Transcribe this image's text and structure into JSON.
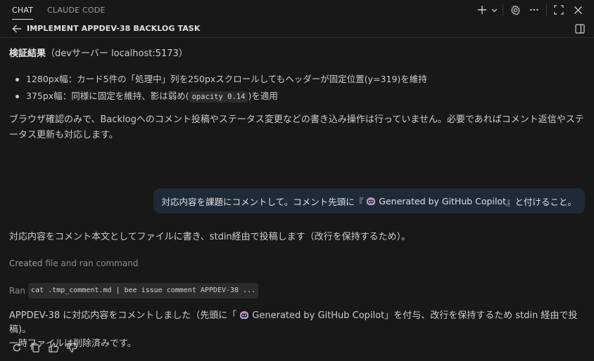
{
  "tabs": {
    "chat": "CHAT",
    "claude_code": "CLAUDE CODE"
  },
  "header": {
    "title": "IMPLEMENT APPDEV-38 BACKLOG TASK"
  },
  "verification": {
    "heading": "検証結果",
    "heading_suffix": "（devサーバー localhost:5173）",
    "bullet1": "1280px幅：カード5件の「処理中」列を250pxスクロールしてもヘッダーが固定位置(y=319)を維持",
    "bullet2_pre": "375px幅：同様に固定を維持、影は弱め(",
    "bullet2_code": "opacity 0.14",
    "bullet2_post": ")を適用"
  },
  "paragraph1": "ブラウザ確認のみで、Backlogへのコメント投稿やステータス変更などの書き込み操作は行っていません。必要であればコメント返信やステータス更新も対応します。",
  "user_message": {
    "pre": "対応内容を課題にコメントして。コメント先頭に『",
    "highlight": "Generated by GitHub Copilot",
    "post": "』と付けること。"
  },
  "response1": "対応内容をコメント本文としてファイルに書き、stdin経由で投稿します（改行を保持するため）。",
  "meta": {
    "created_label": "Created",
    "created_rest": "file and ran command",
    "ran_label": "Ran",
    "ran_command": "cat .tmp_comment.md | bee issue comment APPDEV-38 ..."
  },
  "final": {
    "pre": "APPDEV-38 に対応内容をコメントしました（先頭に「",
    "highlight": "Generated by GitHub Copilot",
    "post": "」を付与、改行を保持するため stdin 経由で投稿)。",
    "line2": "一時ファイルは削除済みです。"
  },
  "icons": {
    "new": "plus-icon",
    "settings": "gear-icon",
    "more": "ellipsis-icon",
    "maximize": "maximize-icon",
    "close": "close-icon",
    "back": "arrow-left-icon",
    "split": "split-panel-icon",
    "retry": "retry-icon",
    "copy": "copy-icon",
    "thumbs_up": "thumbs-up-icon",
    "thumbs_down": "thumbs-down-icon"
  }
}
